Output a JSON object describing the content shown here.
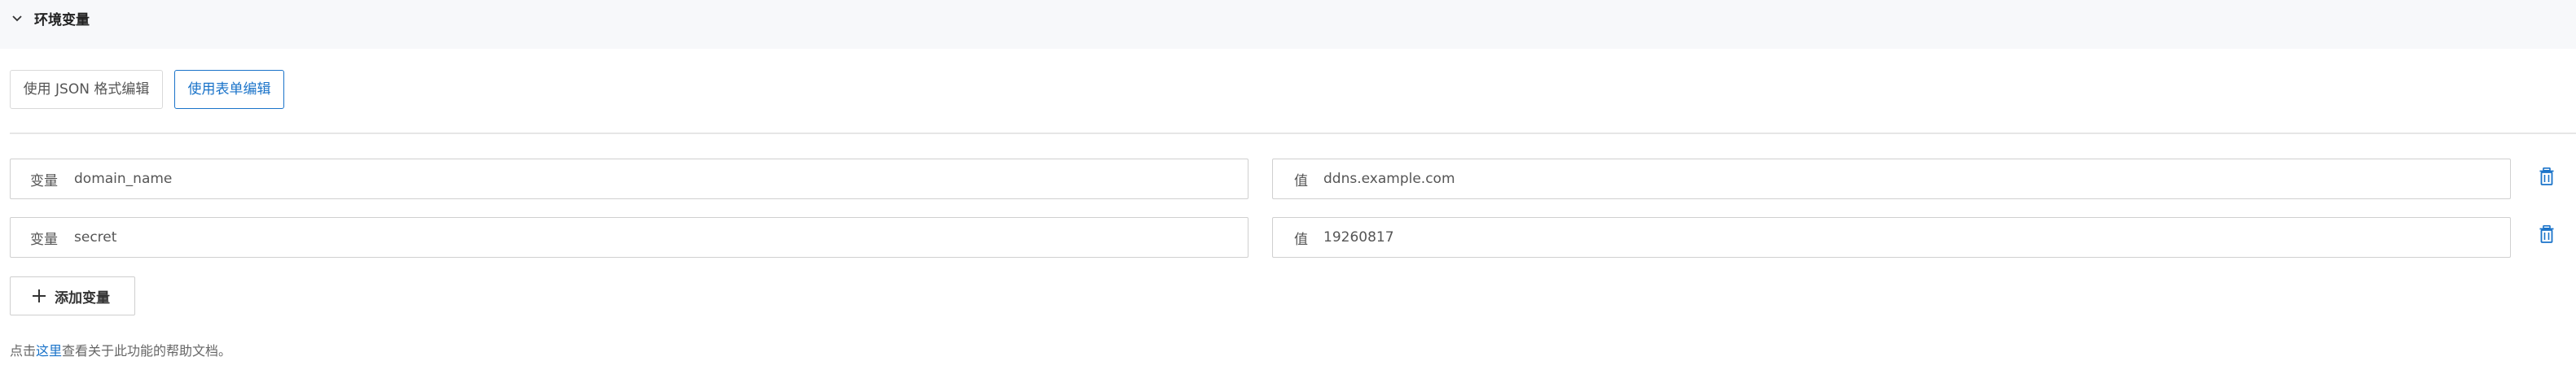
{
  "section": {
    "title": "环境变量",
    "collapse_icon": "chevron-down-icon"
  },
  "mode_tabs": {
    "json_label": "使用 JSON 格式编辑",
    "form_label": "使用表单编辑",
    "active": "form"
  },
  "variables": [
    {
      "key_prefix": "变量",
      "key": "domain_name",
      "value_prefix": "值",
      "value": "ddns.example.com"
    },
    {
      "key_prefix": "变量",
      "key": "secret",
      "value_prefix": "值",
      "value": "19260817"
    }
  ],
  "add_button": {
    "label": "添加变量",
    "icon": "plus-icon"
  },
  "help": {
    "prefix": "点击",
    "link_text": "这里",
    "suffix": "查看关于此功能的帮助文档。"
  },
  "colors": {
    "accent": "#1a73c9",
    "header_bg": "#f7f8fa",
    "border": "#d0d0d0"
  }
}
